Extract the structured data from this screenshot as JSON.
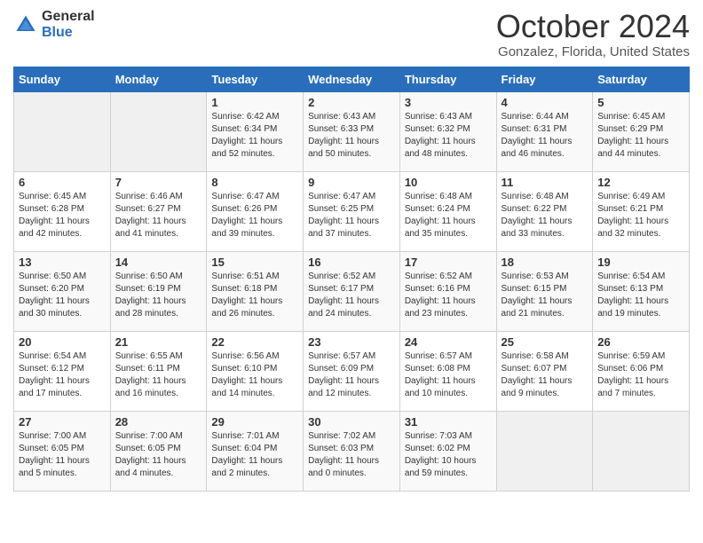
{
  "header": {
    "logo_general": "General",
    "logo_blue": "Blue",
    "month_title": "October 2024",
    "location": "Gonzalez, Florida, United States"
  },
  "days_of_week": [
    "Sunday",
    "Monday",
    "Tuesday",
    "Wednesday",
    "Thursday",
    "Friday",
    "Saturday"
  ],
  "weeks": [
    [
      {
        "day": "",
        "sunrise": "",
        "sunset": "",
        "daylight": ""
      },
      {
        "day": "",
        "sunrise": "",
        "sunset": "",
        "daylight": ""
      },
      {
        "day": "1",
        "sunrise": "Sunrise: 6:42 AM",
        "sunset": "Sunset: 6:34 PM",
        "daylight": "Daylight: 11 hours and 52 minutes."
      },
      {
        "day": "2",
        "sunrise": "Sunrise: 6:43 AM",
        "sunset": "Sunset: 6:33 PM",
        "daylight": "Daylight: 11 hours and 50 minutes."
      },
      {
        "day": "3",
        "sunrise": "Sunrise: 6:43 AM",
        "sunset": "Sunset: 6:32 PM",
        "daylight": "Daylight: 11 hours and 48 minutes."
      },
      {
        "day": "4",
        "sunrise": "Sunrise: 6:44 AM",
        "sunset": "Sunset: 6:31 PM",
        "daylight": "Daylight: 11 hours and 46 minutes."
      },
      {
        "day": "5",
        "sunrise": "Sunrise: 6:45 AM",
        "sunset": "Sunset: 6:29 PM",
        "daylight": "Daylight: 11 hours and 44 minutes."
      }
    ],
    [
      {
        "day": "6",
        "sunrise": "Sunrise: 6:45 AM",
        "sunset": "Sunset: 6:28 PM",
        "daylight": "Daylight: 11 hours and 42 minutes."
      },
      {
        "day": "7",
        "sunrise": "Sunrise: 6:46 AM",
        "sunset": "Sunset: 6:27 PM",
        "daylight": "Daylight: 11 hours and 41 minutes."
      },
      {
        "day": "8",
        "sunrise": "Sunrise: 6:47 AM",
        "sunset": "Sunset: 6:26 PM",
        "daylight": "Daylight: 11 hours and 39 minutes."
      },
      {
        "day": "9",
        "sunrise": "Sunrise: 6:47 AM",
        "sunset": "Sunset: 6:25 PM",
        "daylight": "Daylight: 11 hours and 37 minutes."
      },
      {
        "day": "10",
        "sunrise": "Sunrise: 6:48 AM",
        "sunset": "Sunset: 6:24 PM",
        "daylight": "Daylight: 11 hours and 35 minutes."
      },
      {
        "day": "11",
        "sunrise": "Sunrise: 6:48 AM",
        "sunset": "Sunset: 6:22 PM",
        "daylight": "Daylight: 11 hours and 33 minutes."
      },
      {
        "day": "12",
        "sunrise": "Sunrise: 6:49 AM",
        "sunset": "Sunset: 6:21 PM",
        "daylight": "Daylight: 11 hours and 32 minutes."
      }
    ],
    [
      {
        "day": "13",
        "sunrise": "Sunrise: 6:50 AM",
        "sunset": "Sunset: 6:20 PM",
        "daylight": "Daylight: 11 hours and 30 minutes."
      },
      {
        "day": "14",
        "sunrise": "Sunrise: 6:50 AM",
        "sunset": "Sunset: 6:19 PM",
        "daylight": "Daylight: 11 hours and 28 minutes."
      },
      {
        "day": "15",
        "sunrise": "Sunrise: 6:51 AM",
        "sunset": "Sunset: 6:18 PM",
        "daylight": "Daylight: 11 hours and 26 minutes."
      },
      {
        "day": "16",
        "sunrise": "Sunrise: 6:52 AM",
        "sunset": "Sunset: 6:17 PM",
        "daylight": "Daylight: 11 hours and 24 minutes."
      },
      {
        "day": "17",
        "sunrise": "Sunrise: 6:52 AM",
        "sunset": "Sunset: 6:16 PM",
        "daylight": "Daylight: 11 hours and 23 minutes."
      },
      {
        "day": "18",
        "sunrise": "Sunrise: 6:53 AM",
        "sunset": "Sunset: 6:15 PM",
        "daylight": "Daylight: 11 hours and 21 minutes."
      },
      {
        "day": "19",
        "sunrise": "Sunrise: 6:54 AM",
        "sunset": "Sunset: 6:13 PM",
        "daylight": "Daylight: 11 hours and 19 minutes."
      }
    ],
    [
      {
        "day": "20",
        "sunrise": "Sunrise: 6:54 AM",
        "sunset": "Sunset: 6:12 PM",
        "daylight": "Daylight: 11 hours and 17 minutes."
      },
      {
        "day": "21",
        "sunrise": "Sunrise: 6:55 AM",
        "sunset": "Sunset: 6:11 PM",
        "daylight": "Daylight: 11 hours and 16 minutes."
      },
      {
        "day": "22",
        "sunrise": "Sunrise: 6:56 AM",
        "sunset": "Sunset: 6:10 PM",
        "daylight": "Daylight: 11 hours and 14 minutes."
      },
      {
        "day": "23",
        "sunrise": "Sunrise: 6:57 AM",
        "sunset": "Sunset: 6:09 PM",
        "daylight": "Daylight: 11 hours and 12 minutes."
      },
      {
        "day": "24",
        "sunrise": "Sunrise: 6:57 AM",
        "sunset": "Sunset: 6:08 PM",
        "daylight": "Daylight: 11 hours and 10 minutes."
      },
      {
        "day": "25",
        "sunrise": "Sunrise: 6:58 AM",
        "sunset": "Sunset: 6:07 PM",
        "daylight": "Daylight: 11 hours and 9 minutes."
      },
      {
        "day": "26",
        "sunrise": "Sunrise: 6:59 AM",
        "sunset": "Sunset: 6:06 PM",
        "daylight": "Daylight: 11 hours and 7 minutes."
      }
    ],
    [
      {
        "day": "27",
        "sunrise": "Sunrise: 7:00 AM",
        "sunset": "Sunset: 6:05 PM",
        "daylight": "Daylight: 11 hours and 5 minutes."
      },
      {
        "day": "28",
        "sunrise": "Sunrise: 7:00 AM",
        "sunset": "Sunset: 6:05 PM",
        "daylight": "Daylight: 11 hours and 4 minutes."
      },
      {
        "day": "29",
        "sunrise": "Sunrise: 7:01 AM",
        "sunset": "Sunset: 6:04 PM",
        "daylight": "Daylight: 11 hours and 2 minutes."
      },
      {
        "day": "30",
        "sunrise": "Sunrise: 7:02 AM",
        "sunset": "Sunset: 6:03 PM",
        "daylight": "Daylight: 11 hours and 0 minutes."
      },
      {
        "day": "31",
        "sunrise": "Sunrise: 7:03 AM",
        "sunset": "Sunset: 6:02 PM",
        "daylight": "Daylight: 10 hours and 59 minutes."
      },
      {
        "day": "",
        "sunrise": "",
        "sunset": "",
        "daylight": ""
      },
      {
        "day": "",
        "sunrise": "",
        "sunset": "",
        "daylight": ""
      }
    ]
  ]
}
